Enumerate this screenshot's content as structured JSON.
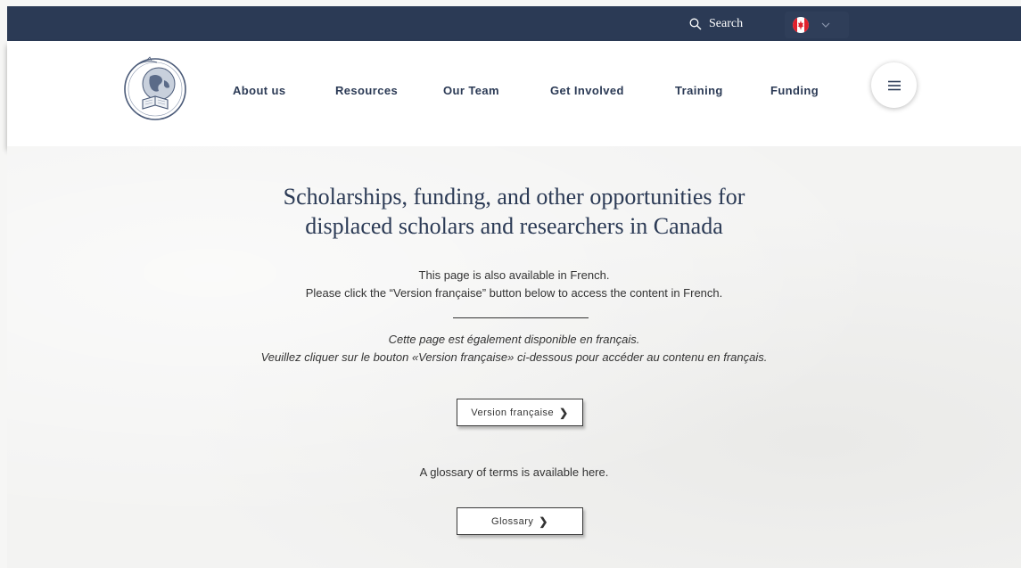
{
  "topbar": {
    "search_label": "Search",
    "bg_color": "#2b3a55",
    "search_icon": "search-icon",
    "language_flag": "canada-flag-icon",
    "language_chevron": "chevron-down-icon"
  },
  "header": {
    "logo": "globe-book-logo",
    "nav": [
      {
        "label": "About us"
      },
      {
        "label": "Resources"
      },
      {
        "label": "Our Team"
      },
      {
        "label": "Get Involved"
      },
      {
        "label": "Training"
      },
      {
        "label": "Funding"
      }
    ],
    "menu_icon": "hamburger-menu-icon"
  },
  "main": {
    "heading_line1": "Scholarships, funding, and other opportunities for",
    "heading_line2": "displaced scholars and researchers in Canada",
    "english_line1": "This page is also available in French.",
    "english_line2": "Please click the “Version française” button below to access the content in French.",
    "french_line1": "Cette page est également disponible en français.",
    "french_line2": "Veuillez cliquer sur le bouton «Version française» ci-dessous pour accéder au contenu en français.",
    "french_button": "Version française",
    "glossary_text": "A glossary of terms is available here.",
    "glossary_button": "Glossary",
    "chevron": "❯"
  }
}
